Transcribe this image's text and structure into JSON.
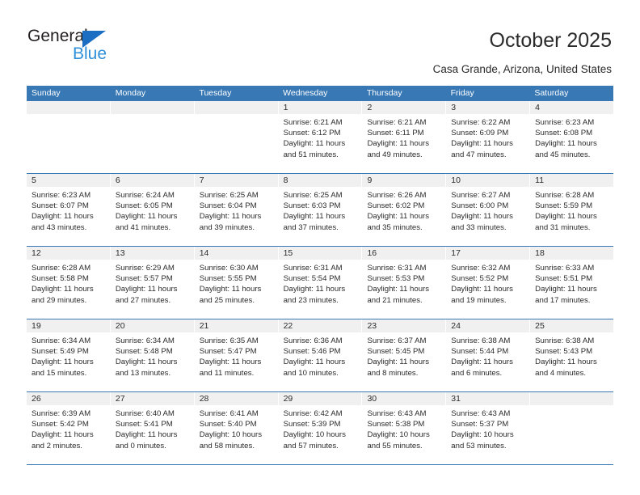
{
  "branding": {
    "logo_primary": "General",
    "logo_secondary": "Blue",
    "logo_triangle_color": "#1b6ec2",
    "logo_blue_color": "#2f8fd8"
  },
  "header": {
    "title": "October 2025",
    "subtitle": "Casa Grande, Arizona, United States"
  },
  "theme": {
    "header_bg": "#3878b4",
    "header_text": "#ffffff",
    "date_band_bg": "#f0f0f0",
    "body_text": "#2b2b2b"
  },
  "weekdays": [
    "Sunday",
    "Monday",
    "Tuesday",
    "Wednesday",
    "Thursday",
    "Friday",
    "Saturday"
  ],
  "weeks": [
    [
      {
        "day": "",
        "empty": true,
        "lines": []
      },
      {
        "day": "",
        "empty": true,
        "lines": []
      },
      {
        "day": "",
        "empty": true,
        "lines": []
      },
      {
        "day": "1",
        "empty": false,
        "lines": [
          "Sunrise: 6:21 AM",
          "Sunset: 6:12 PM",
          "Daylight: 11 hours",
          "and 51 minutes."
        ]
      },
      {
        "day": "2",
        "empty": false,
        "lines": [
          "Sunrise: 6:21 AM",
          "Sunset: 6:11 PM",
          "Daylight: 11 hours",
          "and 49 minutes."
        ]
      },
      {
        "day": "3",
        "empty": false,
        "lines": [
          "Sunrise: 6:22 AM",
          "Sunset: 6:09 PM",
          "Daylight: 11 hours",
          "and 47 minutes."
        ]
      },
      {
        "day": "4",
        "empty": false,
        "lines": [
          "Sunrise: 6:23 AM",
          "Sunset: 6:08 PM",
          "Daylight: 11 hours",
          "and 45 minutes."
        ]
      }
    ],
    [
      {
        "day": "5",
        "empty": false,
        "lines": [
          "Sunrise: 6:23 AM",
          "Sunset: 6:07 PM",
          "Daylight: 11 hours",
          "and 43 minutes."
        ]
      },
      {
        "day": "6",
        "empty": false,
        "lines": [
          "Sunrise: 6:24 AM",
          "Sunset: 6:05 PM",
          "Daylight: 11 hours",
          "and 41 minutes."
        ]
      },
      {
        "day": "7",
        "empty": false,
        "lines": [
          "Sunrise: 6:25 AM",
          "Sunset: 6:04 PM",
          "Daylight: 11 hours",
          "and 39 minutes."
        ]
      },
      {
        "day": "8",
        "empty": false,
        "lines": [
          "Sunrise: 6:25 AM",
          "Sunset: 6:03 PM",
          "Daylight: 11 hours",
          "and 37 minutes."
        ]
      },
      {
        "day": "9",
        "empty": false,
        "lines": [
          "Sunrise: 6:26 AM",
          "Sunset: 6:02 PM",
          "Daylight: 11 hours",
          "and 35 minutes."
        ]
      },
      {
        "day": "10",
        "empty": false,
        "lines": [
          "Sunrise: 6:27 AM",
          "Sunset: 6:00 PM",
          "Daylight: 11 hours",
          "and 33 minutes."
        ]
      },
      {
        "day": "11",
        "empty": false,
        "lines": [
          "Sunrise: 6:28 AM",
          "Sunset: 5:59 PM",
          "Daylight: 11 hours",
          "and 31 minutes."
        ]
      }
    ],
    [
      {
        "day": "12",
        "empty": false,
        "lines": [
          "Sunrise: 6:28 AM",
          "Sunset: 5:58 PM",
          "Daylight: 11 hours",
          "and 29 minutes."
        ]
      },
      {
        "day": "13",
        "empty": false,
        "lines": [
          "Sunrise: 6:29 AM",
          "Sunset: 5:57 PM",
          "Daylight: 11 hours",
          "and 27 minutes."
        ]
      },
      {
        "day": "14",
        "empty": false,
        "lines": [
          "Sunrise: 6:30 AM",
          "Sunset: 5:55 PM",
          "Daylight: 11 hours",
          "and 25 minutes."
        ]
      },
      {
        "day": "15",
        "empty": false,
        "lines": [
          "Sunrise: 6:31 AM",
          "Sunset: 5:54 PM",
          "Daylight: 11 hours",
          "and 23 minutes."
        ]
      },
      {
        "day": "16",
        "empty": false,
        "lines": [
          "Sunrise: 6:31 AM",
          "Sunset: 5:53 PM",
          "Daylight: 11 hours",
          "and 21 minutes."
        ]
      },
      {
        "day": "17",
        "empty": false,
        "lines": [
          "Sunrise: 6:32 AM",
          "Sunset: 5:52 PM",
          "Daylight: 11 hours",
          "and 19 minutes."
        ]
      },
      {
        "day": "18",
        "empty": false,
        "lines": [
          "Sunrise: 6:33 AM",
          "Sunset: 5:51 PM",
          "Daylight: 11 hours",
          "and 17 minutes."
        ]
      }
    ],
    [
      {
        "day": "19",
        "empty": false,
        "lines": [
          "Sunrise: 6:34 AM",
          "Sunset: 5:49 PM",
          "Daylight: 11 hours",
          "and 15 minutes."
        ]
      },
      {
        "day": "20",
        "empty": false,
        "lines": [
          "Sunrise: 6:34 AM",
          "Sunset: 5:48 PM",
          "Daylight: 11 hours",
          "and 13 minutes."
        ]
      },
      {
        "day": "21",
        "empty": false,
        "lines": [
          "Sunrise: 6:35 AM",
          "Sunset: 5:47 PM",
          "Daylight: 11 hours",
          "and 11 minutes."
        ]
      },
      {
        "day": "22",
        "empty": false,
        "lines": [
          "Sunrise: 6:36 AM",
          "Sunset: 5:46 PM",
          "Daylight: 11 hours",
          "and 10 minutes."
        ]
      },
      {
        "day": "23",
        "empty": false,
        "lines": [
          "Sunrise: 6:37 AM",
          "Sunset: 5:45 PM",
          "Daylight: 11 hours",
          "and 8 minutes."
        ]
      },
      {
        "day": "24",
        "empty": false,
        "lines": [
          "Sunrise: 6:38 AM",
          "Sunset: 5:44 PM",
          "Daylight: 11 hours",
          "and 6 minutes."
        ]
      },
      {
        "day": "25",
        "empty": false,
        "lines": [
          "Sunrise: 6:38 AM",
          "Sunset: 5:43 PM",
          "Daylight: 11 hours",
          "and 4 minutes."
        ]
      }
    ],
    [
      {
        "day": "26",
        "empty": false,
        "lines": [
          "Sunrise: 6:39 AM",
          "Sunset: 5:42 PM",
          "Daylight: 11 hours",
          "and 2 minutes."
        ]
      },
      {
        "day": "27",
        "empty": false,
        "lines": [
          "Sunrise: 6:40 AM",
          "Sunset: 5:41 PM",
          "Daylight: 11 hours",
          "and 0 minutes."
        ]
      },
      {
        "day": "28",
        "empty": false,
        "lines": [
          "Sunrise: 6:41 AM",
          "Sunset: 5:40 PM",
          "Daylight: 10 hours",
          "and 58 minutes."
        ]
      },
      {
        "day": "29",
        "empty": false,
        "lines": [
          "Sunrise: 6:42 AM",
          "Sunset: 5:39 PM",
          "Daylight: 10 hours",
          "and 57 minutes."
        ]
      },
      {
        "day": "30",
        "empty": false,
        "lines": [
          "Sunrise: 6:43 AM",
          "Sunset: 5:38 PM",
          "Daylight: 10 hours",
          "and 55 minutes."
        ]
      },
      {
        "day": "31",
        "empty": false,
        "lines": [
          "Sunrise: 6:43 AM",
          "Sunset: 5:37 PM",
          "Daylight: 10 hours",
          "and 53 minutes."
        ]
      },
      {
        "day": "",
        "empty": true,
        "lines": []
      }
    ]
  ]
}
